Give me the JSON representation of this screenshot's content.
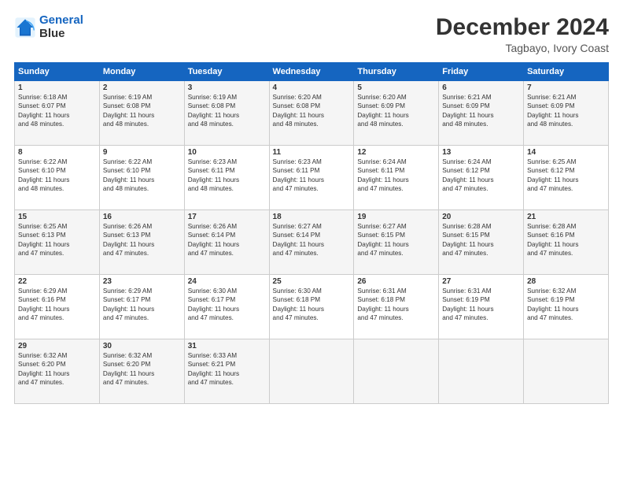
{
  "logo": {
    "line1": "General",
    "line2": "Blue"
  },
  "title": "December 2024",
  "subtitle": "Tagbayo, Ivory Coast",
  "days_header": [
    "Sunday",
    "Monday",
    "Tuesday",
    "Wednesday",
    "Thursday",
    "Friday",
    "Saturday"
  ],
  "weeks": [
    [
      {
        "day": "1",
        "rise": "6:18 AM",
        "set": "6:07 PM",
        "hours": "11",
        "mins": "48"
      },
      {
        "day": "2",
        "rise": "6:19 AM",
        "set": "6:08 PM",
        "hours": "11",
        "mins": "48"
      },
      {
        "day": "3",
        "rise": "6:19 AM",
        "set": "6:08 PM",
        "hours": "11",
        "mins": "48"
      },
      {
        "day": "4",
        "rise": "6:20 AM",
        "set": "6:08 PM",
        "hours": "11",
        "mins": "48"
      },
      {
        "day": "5",
        "rise": "6:20 AM",
        "set": "6:09 PM",
        "hours": "11",
        "mins": "48"
      },
      {
        "day": "6",
        "rise": "6:21 AM",
        "set": "6:09 PM",
        "hours": "11",
        "mins": "48"
      },
      {
        "day": "7",
        "rise": "6:21 AM",
        "set": "6:09 PM",
        "hours": "11",
        "mins": "48"
      }
    ],
    [
      {
        "day": "8",
        "rise": "6:22 AM",
        "set": "6:10 PM",
        "hours": "11",
        "mins": "48"
      },
      {
        "day": "9",
        "rise": "6:22 AM",
        "set": "6:10 PM",
        "hours": "11",
        "mins": "48"
      },
      {
        "day": "10",
        "rise": "6:23 AM",
        "set": "6:11 PM",
        "hours": "11",
        "mins": "48"
      },
      {
        "day": "11",
        "rise": "6:23 AM",
        "set": "6:11 PM",
        "hours": "11",
        "mins": "47"
      },
      {
        "day": "12",
        "rise": "6:24 AM",
        "set": "6:11 PM",
        "hours": "11",
        "mins": "47"
      },
      {
        "day": "13",
        "rise": "6:24 AM",
        "set": "6:12 PM",
        "hours": "11",
        "mins": "47"
      },
      {
        "day": "14",
        "rise": "6:25 AM",
        "set": "6:12 PM",
        "hours": "11",
        "mins": "47"
      }
    ],
    [
      {
        "day": "15",
        "rise": "6:25 AM",
        "set": "6:13 PM",
        "hours": "11",
        "mins": "47"
      },
      {
        "day": "16",
        "rise": "6:26 AM",
        "set": "6:13 PM",
        "hours": "11",
        "mins": "47"
      },
      {
        "day": "17",
        "rise": "6:26 AM",
        "set": "6:14 PM",
        "hours": "11",
        "mins": "47"
      },
      {
        "day": "18",
        "rise": "6:27 AM",
        "set": "6:14 PM",
        "hours": "11",
        "mins": "47"
      },
      {
        "day": "19",
        "rise": "6:27 AM",
        "set": "6:15 PM",
        "hours": "11",
        "mins": "47"
      },
      {
        "day": "20",
        "rise": "6:28 AM",
        "set": "6:15 PM",
        "hours": "11",
        "mins": "47"
      },
      {
        "day": "21",
        "rise": "6:28 AM",
        "set": "6:16 PM",
        "hours": "11",
        "mins": "47"
      }
    ],
    [
      {
        "day": "22",
        "rise": "6:29 AM",
        "set": "6:16 PM",
        "hours": "11",
        "mins": "47"
      },
      {
        "day": "23",
        "rise": "6:29 AM",
        "set": "6:17 PM",
        "hours": "11",
        "mins": "47"
      },
      {
        "day": "24",
        "rise": "6:30 AM",
        "set": "6:17 PM",
        "hours": "11",
        "mins": "47"
      },
      {
        "day": "25",
        "rise": "6:30 AM",
        "set": "6:18 PM",
        "hours": "11",
        "mins": "47"
      },
      {
        "day": "26",
        "rise": "6:31 AM",
        "set": "6:18 PM",
        "hours": "11",
        "mins": "47"
      },
      {
        "day": "27",
        "rise": "6:31 AM",
        "set": "6:19 PM",
        "hours": "11",
        "mins": "47"
      },
      {
        "day": "28",
        "rise": "6:32 AM",
        "set": "6:19 PM",
        "hours": "11",
        "mins": "47"
      }
    ],
    [
      {
        "day": "29",
        "rise": "6:32 AM",
        "set": "6:20 PM",
        "hours": "11",
        "mins": "47"
      },
      {
        "day": "30",
        "rise": "6:32 AM",
        "set": "6:20 PM",
        "hours": "11",
        "mins": "47"
      },
      {
        "day": "31",
        "rise": "6:33 AM",
        "set": "6:21 PM",
        "hours": "11",
        "mins": "47"
      },
      null,
      null,
      null,
      null
    ]
  ]
}
